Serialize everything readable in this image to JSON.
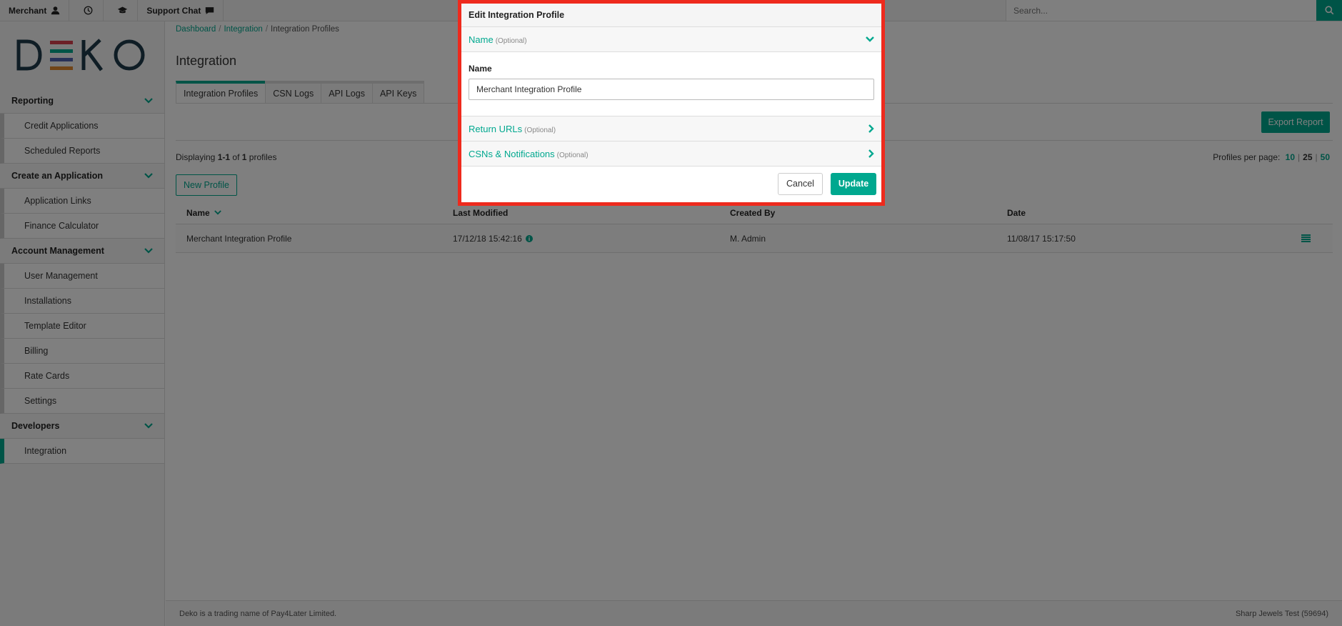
{
  "topbar": {
    "merchant_label": "Merchant",
    "support_label": "Support Chat",
    "search_placeholder": "Search..."
  },
  "sidebar": {
    "logo_text": "DEKO",
    "sections": [
      {
        "label": "Reporting",
        "items": [
          "Credit Applications",
          "Scheduled Reports"
        ]
      },
      {
        "label": "Create an Application",
        "items": [
          "Application Links",
          "Finance Calculator"
        ]
      },
      {
        "label": "Account Management",
        "items": [
          "User Management",
          "Installations",
          "Template Editor",
          "Billing",
          "Rate Cards",
          "Settings"
        ]
      },
      {
        "label": "Developers",
        "items": [
          "Integration"
        ]
      }
    ],
    "active_item": "Integration"
  },
  "breadcrumb": {
    "items": [
      "Dashboard",
      "Integration",
      "Integration Profiles"
    ],
    "sep": "/"
  },
  "page": {
    "title": "Integration",
    "tabs": [
      "Integration Profiles",
      "CSN Logs",
      "API Logs",
      "API Keys"
    ],
    "export_label": "Export Report",
    "displaying_prefix": "Displaying",
    "displaying_range": "1-1",
    "displaying_of": "of",
    "displaying_count": "1",
    "displaying_suffix": "profiles",
    "per_page_label": "Profiles per page:",
    "per_page_options": [
      "10",
      "25",
      "50"
    ],
    "bar": "|",
    "new_profile_label": "New Profile"
  },
  "table": {
    "headers": [
      "Name",
      "Last Modified",
      "Created By",
      "Date"
    ],
    "rows": [
      {
        "name": "Merchant Integration Profile",
        "last_modified": "17/12/18 15:42:16",
        "created_by": "M. Admin",
        "date": "11/08/17 15:17:50"
      }
    ]
  },
  "footer": {
    "left": "Deko is a trading name of Pay4Later Limited.",
    "right": "Sharp Jewels Test (59694)"
  },
  "modal": {
    "title": "Edit Integration Profile",
    "sections": [
      {
        "title": "Name",
        "optional": "(Optional)"
      },
      {
        "title": "Return URLs",
        "optional": "(Optional)"
      },
      {
        "title": "CSNs & Notifications",
        "optional": "(Optional)"
      }
    ],
    "field_label": "Name",
    "field_value": "Merchant Integration Profile",
    "cancel_label": "Cancel",
    "update_label": "Update"
  },
  "colors": {
    "accent": "#00a88f",
    "highlight": "#ee2a1d",
    "logo_bars": [
      "#d9404e",
      "#00a88f",
      "#4f62b0",
      "#e0892e"
    ]
  }
}
